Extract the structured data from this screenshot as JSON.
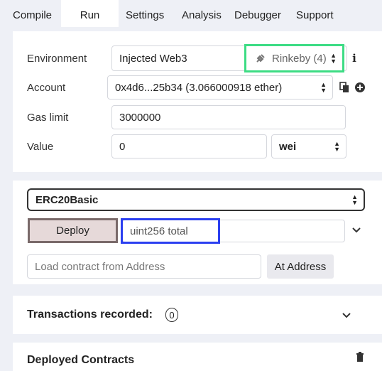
{
  "tabs": [
    {
      "label": "Compile"
    },
    {
      "label": "Run"
    },
    {
      "label": "Settings"
    },
    {
      "label": "Analysis"
    },
    {
      "label": "Debugger"
    },
    {
      "label": "Support"
    }
  ],
  "active_tab": "Run",
  "settings": {
    "environment": {
      "label": "Environment",
      "value": "Injected Web3",
      "network": "Rinkeby (4)"
    },
    "account": {
      "label": "Account",
      "value": "0x4d6...25b34 (3.066000918 ether)"
    },
    "gas_limit": {
      "label": "Gas limit",
      "value": "3000000"
    },
    "value": {
      "label": "Value",
      "amount": "0",
      "unit": "wei"
    }
  },
  "contract": {
    "selected": "ERC20Basic",
    "deploy_label": "Deploy",
    "constructor_placeholder": "uint256 total",
    "load_placeholder": "Load contract from Address",
    "at_address_label": "At Address"
  },
  "transactions": {
    "label": "Transactions recorded:",
    "count": "0"
  },
  "deployed": {
    "label": "Deployed Contracts"
  },
  "colors": {
    "highlight_green": "#3ddc84",
    "highlight_blue": "#2b3ff0"
  }
}
